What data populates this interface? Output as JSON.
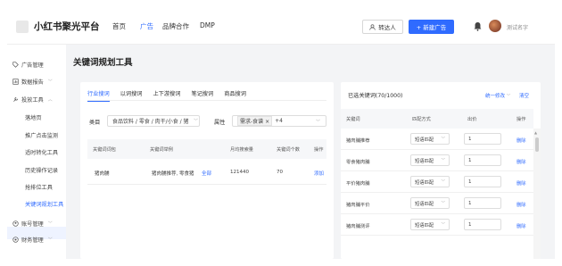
{
  "header": {
    "brand": "小红书聚光平台",
    "nav": [
      "首页",
      "广告",
      "品牌合作",
      "DMP"
    ],
    "active_nav": "广告",
    "transfer_label": "转达人",
    "new_ad_label": "+ 新建广告",
    "username": "测试名字"
  },
  "sidebar": {
    "items": [
      {
        "label": "广告管理",
        "icon": "tag-icon"
      },
      {
        "label": "数据报告",
        "icon": "report-icon"
      },
      {
        "label": "投放工具",
        "icon": "tool-icon"
      }
    ],
    "sub_items": [
      "落地页",
      "推广点击监测",
      "适时转化工具",
      "历史操作记录",
      "抢排位工具",
      "关键词规划工具"
    ],
    "active_sub": "关键词规划工具",
    "bottom_items": [
      {
        "label": "账号管理",
        "icon": "account-icon"
      },
      {
        "label": "财务管理",
        "icon": "finance-icon"
      }
    ]
  },
  "main": {
    "title": "关键词规划工具",
    "tabs": [
      "行业搜词",
      "以词搜词",
      "上下游搜词",
      "笔记搜词",
      "商品搜词"
    ],
    "active_tab": "行业搜词",
    "filters": {
      "category_label": "类目",
      "category_value": "食品饮料 / 零食 / 肉干/小食 / 猪",
      "attr_label": "属性",
      "attr_tag": "需求-食谱",
      "attr_more": "+4"
    },
    "table": {
      "headers": [
        "关键词词包",
        "关键词举例",
        "月均搜索量",
        "关键词个数",
        "操作"
      ],
      "rows": [
        {
          "pack": "猪肉脯",
          "example": "猪肉脯推荐, 零食猪",
          "more": "全部",
          "volume": "121440",
          "count": "70",
          "action": "添加"
        }
      ]
    }
  },
  "selected": {
    "title": "已选关键词(70/1000)",
    "batch_label": "统一修改",
    "clear_label": "清空",
    "headers": [
      "关键词",
      "匹配方式",
      "出价",
      "操作"
    ],
    "rows": [
      {
        "keyword": "猪肉脯推荐",
        "match": "短语匹配",
        "bid": "1",
        "action": "删除"
      },
      {
        "keyword": "零食猪肉脯",
        "match": "短语匹配",
        "bid": "1",
        "action": "删除"
      },
      {
        "keyword": "平价猪肉脯",
        "match": "短语匹配",
        "bid": "1",
        "action": "删除"
      },
      {
        "keyword": "猪肉脯平价",
        "match": "短语匹配",
        "bid": "1",
        "action": "删除"
      },
      {
        "keyword": "猪肉脯测评",
        "match": "短语匹配",
        "bid": "1",
        "action": "删除"
      }
    ]
  },
  "colors": {
    "accent": "#2f6bff",
    "background": "#f3f4f6"
  }
}
